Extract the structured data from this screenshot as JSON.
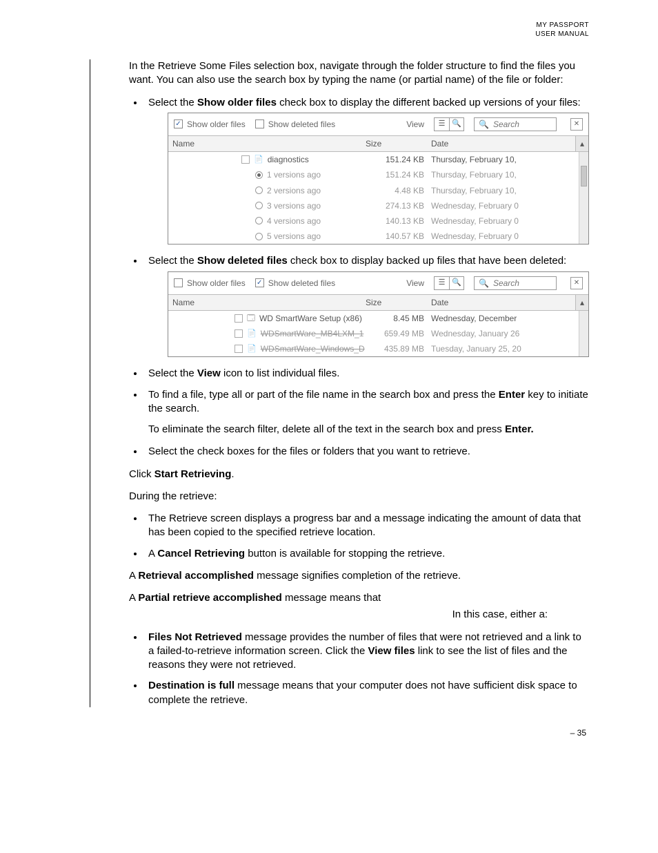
{
  "header": {
    "line1": "MY PASSPORT",
    "line2": "USER MANUAL"
  },
  "intro": "In the Retrieve Some Files selection box, navigate through the folder structure to find the files you want. You can also use the search box by typing the name (or partial name) of the file or folder:",
  "b1_pre": "Select the ",
  "b1_bold": "Show older files",
  "b1_post": " check box to display the different backed up versions of your files:",
  "panel1": {
    "show_older": "Show older files",
    "show_deleted": "Show deleted files",
    "view": "View",
    "search_placeholder": "Search",
    "cols": {
      "name": "Name",
      "size": "Size",
      "date": "Date"
    },
    "r0": {
      "name": "diagnostics",
      "size": "151.24 KB",
      "date": "Thursday, February 10,"
    },
    "r1": {
      "name": "1 versions ago",
      "size": "151.24 KB",
      "date": "Thursday, February 10,"
    },
    "r2": {
      "name": "2 versions ago",
      "size": "4.48 KB",
      "date": "Thursday, February 10,"
    },
    "r3": {
      "name": "3 versions ago",
      "size": "274.13 KB",
      "date": "Wednesday, February 0"
    },
    "r4": {
      "name": "4 versions ago",
      "size": "140.13 KB",
      "date": "Wednesday, February 0"
    },
    "r5": {
      "name": "5 versions ago",
      "size": "140.57 KB",
      "date": "Wednesday, February 0"
    }
  },
  "b2_pre": "Select the ",
  "b2_bold": "Show deleted files",
  "b2_post": " check box to display backed up files that have been deleted:",
  "panel2": {
    "show_older": "Show older files",
    "show_deleted": "Show deleted files",
    "view": "View",
    "search_placeholder": "Search",
    "cols": {
      "name": "Name",
      "size": "Size",
      "date": "Date"
    },
    "r0": {
      "name": "WD SmartWare Setup (x86)",
      "size": "8.45 MB",
      "date": "Wednesday, December"
    },
    "r1": {
      "name": "WDSmartWare_MB4LXM_1",
      "size": "659.49 MB",
      "date": "Wednesday, January 26"
    },
    "r2": {
      "name": "WDSmartWare_Windows_D",
      "size": "435.89 MB",
      "date": "Tuesday, January 25, 20"
    }
  },
  "b3_pre": "Select the ",
  "b3_bold": "View",
  "b3_post": " icon to list individual files.",
  "b4_pre": "To find a file, type all or part of the file name in the search box and press the ",
  "b4_bold": "Enter",
  "b4_post": " key to initiate the search.",
  "b4_sub_pre": "To eliminate the search filter, delete all of the text in the search box and press ",
  "b4_sub_bold": "Enter.",
  "b5": "Select the check boxes for the files or folders that you want to retrieve.",
  "p_click_pre": "Click ",
  "p_click_bold": "Start Retrieving",
  "p_click_post": ".",
  "p_during": "During the retrieve:",
  "b6": "The Retrieve screen displays a progress bar and a message indicating the amount of data that has been copied to the specified retrieve location.",
  "b7_pre": "A ",
  "b7_bold": "Cancel Retrieving",
  "b7_post": " button is available for stopping the retrieve.",
  "p_ra_pre": "A ",
  "p_ra_bold": "Retrieval accomplished",
  "p_ra_post": " message signifies completion of the retrieve.",
  "p_pra_pre": "A ",
  "p_pra_bold": "Partial retrieve accomplished",
  "p_pra_post": " message means that",
  "p_either": "In this case, either a:",
  "b8_bold": "Files Not Retrieved",
  "b8_mid": " message provides the number of files that were not retrieved and a link to a failed-to-retrieve information screen. Click the ",
  "b8_bold2": "View files",
  "b8_post": " link to see the list of files and the reasons they were not retrieved.",
  "b9_bold": "Destination is full",
  "b9_post": " message means that your computer does not have sufficient disk space to complete the retrieve.",
  "footer": "– 35"
}
